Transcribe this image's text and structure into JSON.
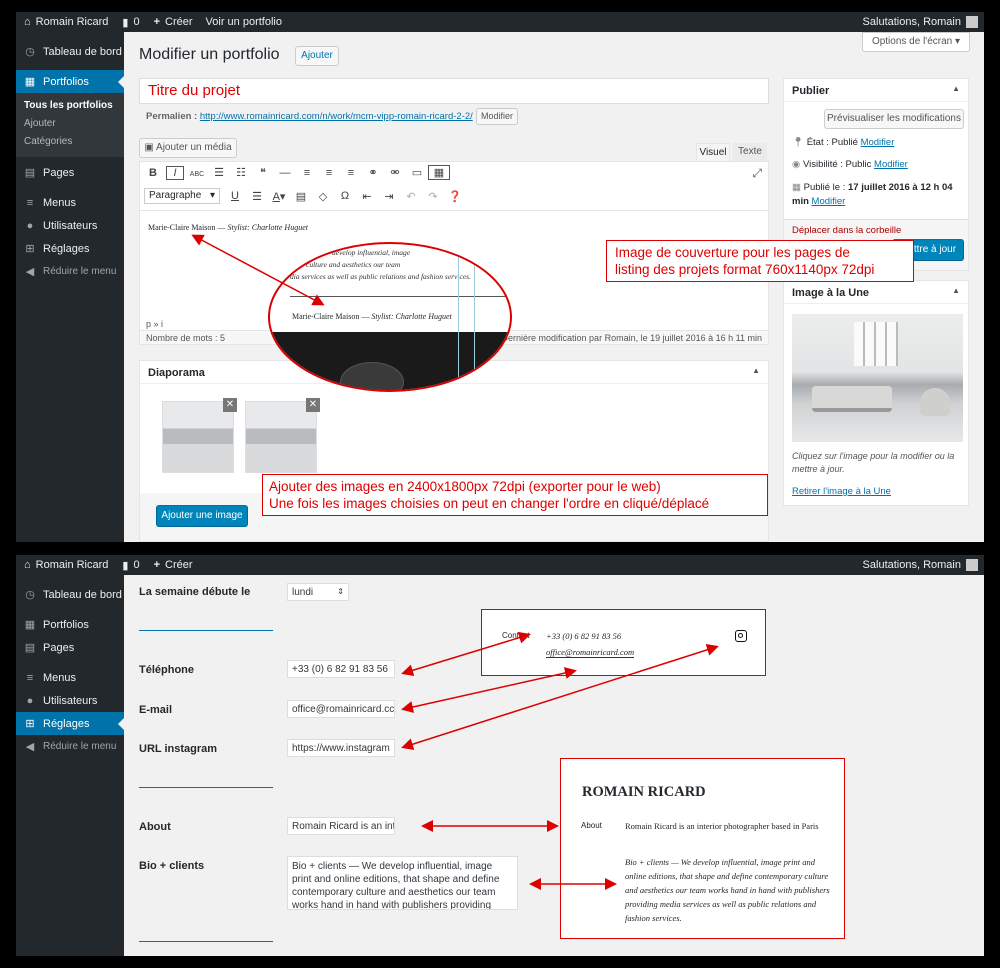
{
  "top": {
    "site_name": "Romain Ricard",
    "comments_count": "0",
    "new_label": "Créer",
    "view_label": "Voir un portfolio",
    "greeting": "Salutations, Romain"
  },
  "menu1": {
    "dashboard": "Tableau de bord",
    "portfolios": "Portfolios",
    "sub": [
      "Tous les portfolios",
      "Ajouter",
      "Catégories"
    ],
    "pages": "Pages",
    "menus": "Menus",
    "users": "Utilisateurs",
    "settings": "Réglages",
    "collapse": "Réduire le menu"
  },
  "editor": {
    "page_title": "Modifier un portfolio",
    "add_button": "Ajouter",
    "screen_options": "Options de l'écran",
    "title_value": "Titre du projet",
    "permalink_label": "Permalien :",
    "permalink_url": "http://www.romainricard.com/n/work/mcm-vipp-romain-ricard-2-2/",
    "modify_button": "Modifier",
    "add_media": "Ajouter un média",
    "tab_visual": "Visuel",
    "tab_text": "Texte",
    "format_select": "Paragraphe",
    "content_prefix": "Marie-Claire Maison —",
    "content_italic": "Stylist: Charlotte Huguet",
    "path": "p » i",
    "word_count": "Nombre de mots : 5",
    "last_modified": "Dernière modification par Romain, le 19 juillet 2016 à 16 h 11 min",
    "zoom_line1": "develop influential, image",
    "zoom_line2": "culture and aesthetics our team",
    "zoom_line3": "dia services as well as public relations and fashion services.",
    "zoom_caption_prefix": "Marie-Claire Maison —",
    "zoom_caption_italic": "Stylist: Charlotte Huguet"
  },
  "publish": {
    "title": "Publier",
    "preview": "Prévisualiser les modifications",
    "status_label": "État : Publié",
    "status_link": "Modifier",
    "visibility_label": "Visibilité : Public",
    "visibility_link": "Modifier",
    "published_prefix": "Publié le :",
    "published_date": "17 juillet 2016 à 12 h 04",
    "published_suffix": "min",
    "published_link": "Modifier",
    "trash": "Déplacer dans la corbeille",
    "update": "Mettre à jour"
  },
  "featured": {
    "title": "Image à la Une",
    "caption": "Cliquez sur l'image pour la modifier ou la mettre à jour.",
    "remove": "Retirer l'image à la Une"
  },
  "slideshow": {
    "title": "Diaporama",
    "add_button": "Ajouter une image"
  },
  "notes": {
    "cover_line1": "Image de couverture pour les pages de",
    "cover_line2": "listing des projets format 760x1140px 72dpi",
    "slides_line1": "Ajouter des images en 2400x1800px 72dpi (exporter pour le web)",
    "slides_line2": "Une fois les images choisies on peut en changer l'ordre en cliqué/déplacé"
  },
  "menu2": {
    "dashboard": "Tableau de bord",
    "portfolios": "Portfolios",
    "pages": "Pages",
    "menus": "Menus",
    "users": "Utilisateurs",
    "settings": "Réglages",
    "collapse": "Réduire le menu"
  },
  "settings": {
    "week_label": "La semaine débute le",
    "week_value": "lundi",
    "phone_label": "Téléphone",
    "phone_value": "+33 (0) 6 82 91 83 56",
    "email_label": "E-mail",
    "email_value": "office@romainricard.cc",
    "insta_label": "URL instagram",
    "insta_value": "https://www.instagram",
    "about_label": "About",
    "about_value": "Romain Ricard is an int",
    "bio_label": "Bio + clients",
    "bio_value": "Bio + clients — We develop influential, image print and online editions, that shape and define contemporary culture and aesthetics our team works hand in hand with publishers providing"
  },
  "preview": {
    "contact_label": "Contact",
    "phone": "+33 (0) 6 82 91 83 56",
    "email": "office@romainricard.com",
    "name": "ROMAIN RICARD",
    "about_label": "About",
    "about_text": "Romain Ricard is an interior photographer based in Paris",
    "bio_text": "Bio + clients — We develop influential, image print and online editions, that shape and define contemporary culture and aesthetics our team works hand in hand with publishers providing media services as well as public relations and fashion services."
  }
}
